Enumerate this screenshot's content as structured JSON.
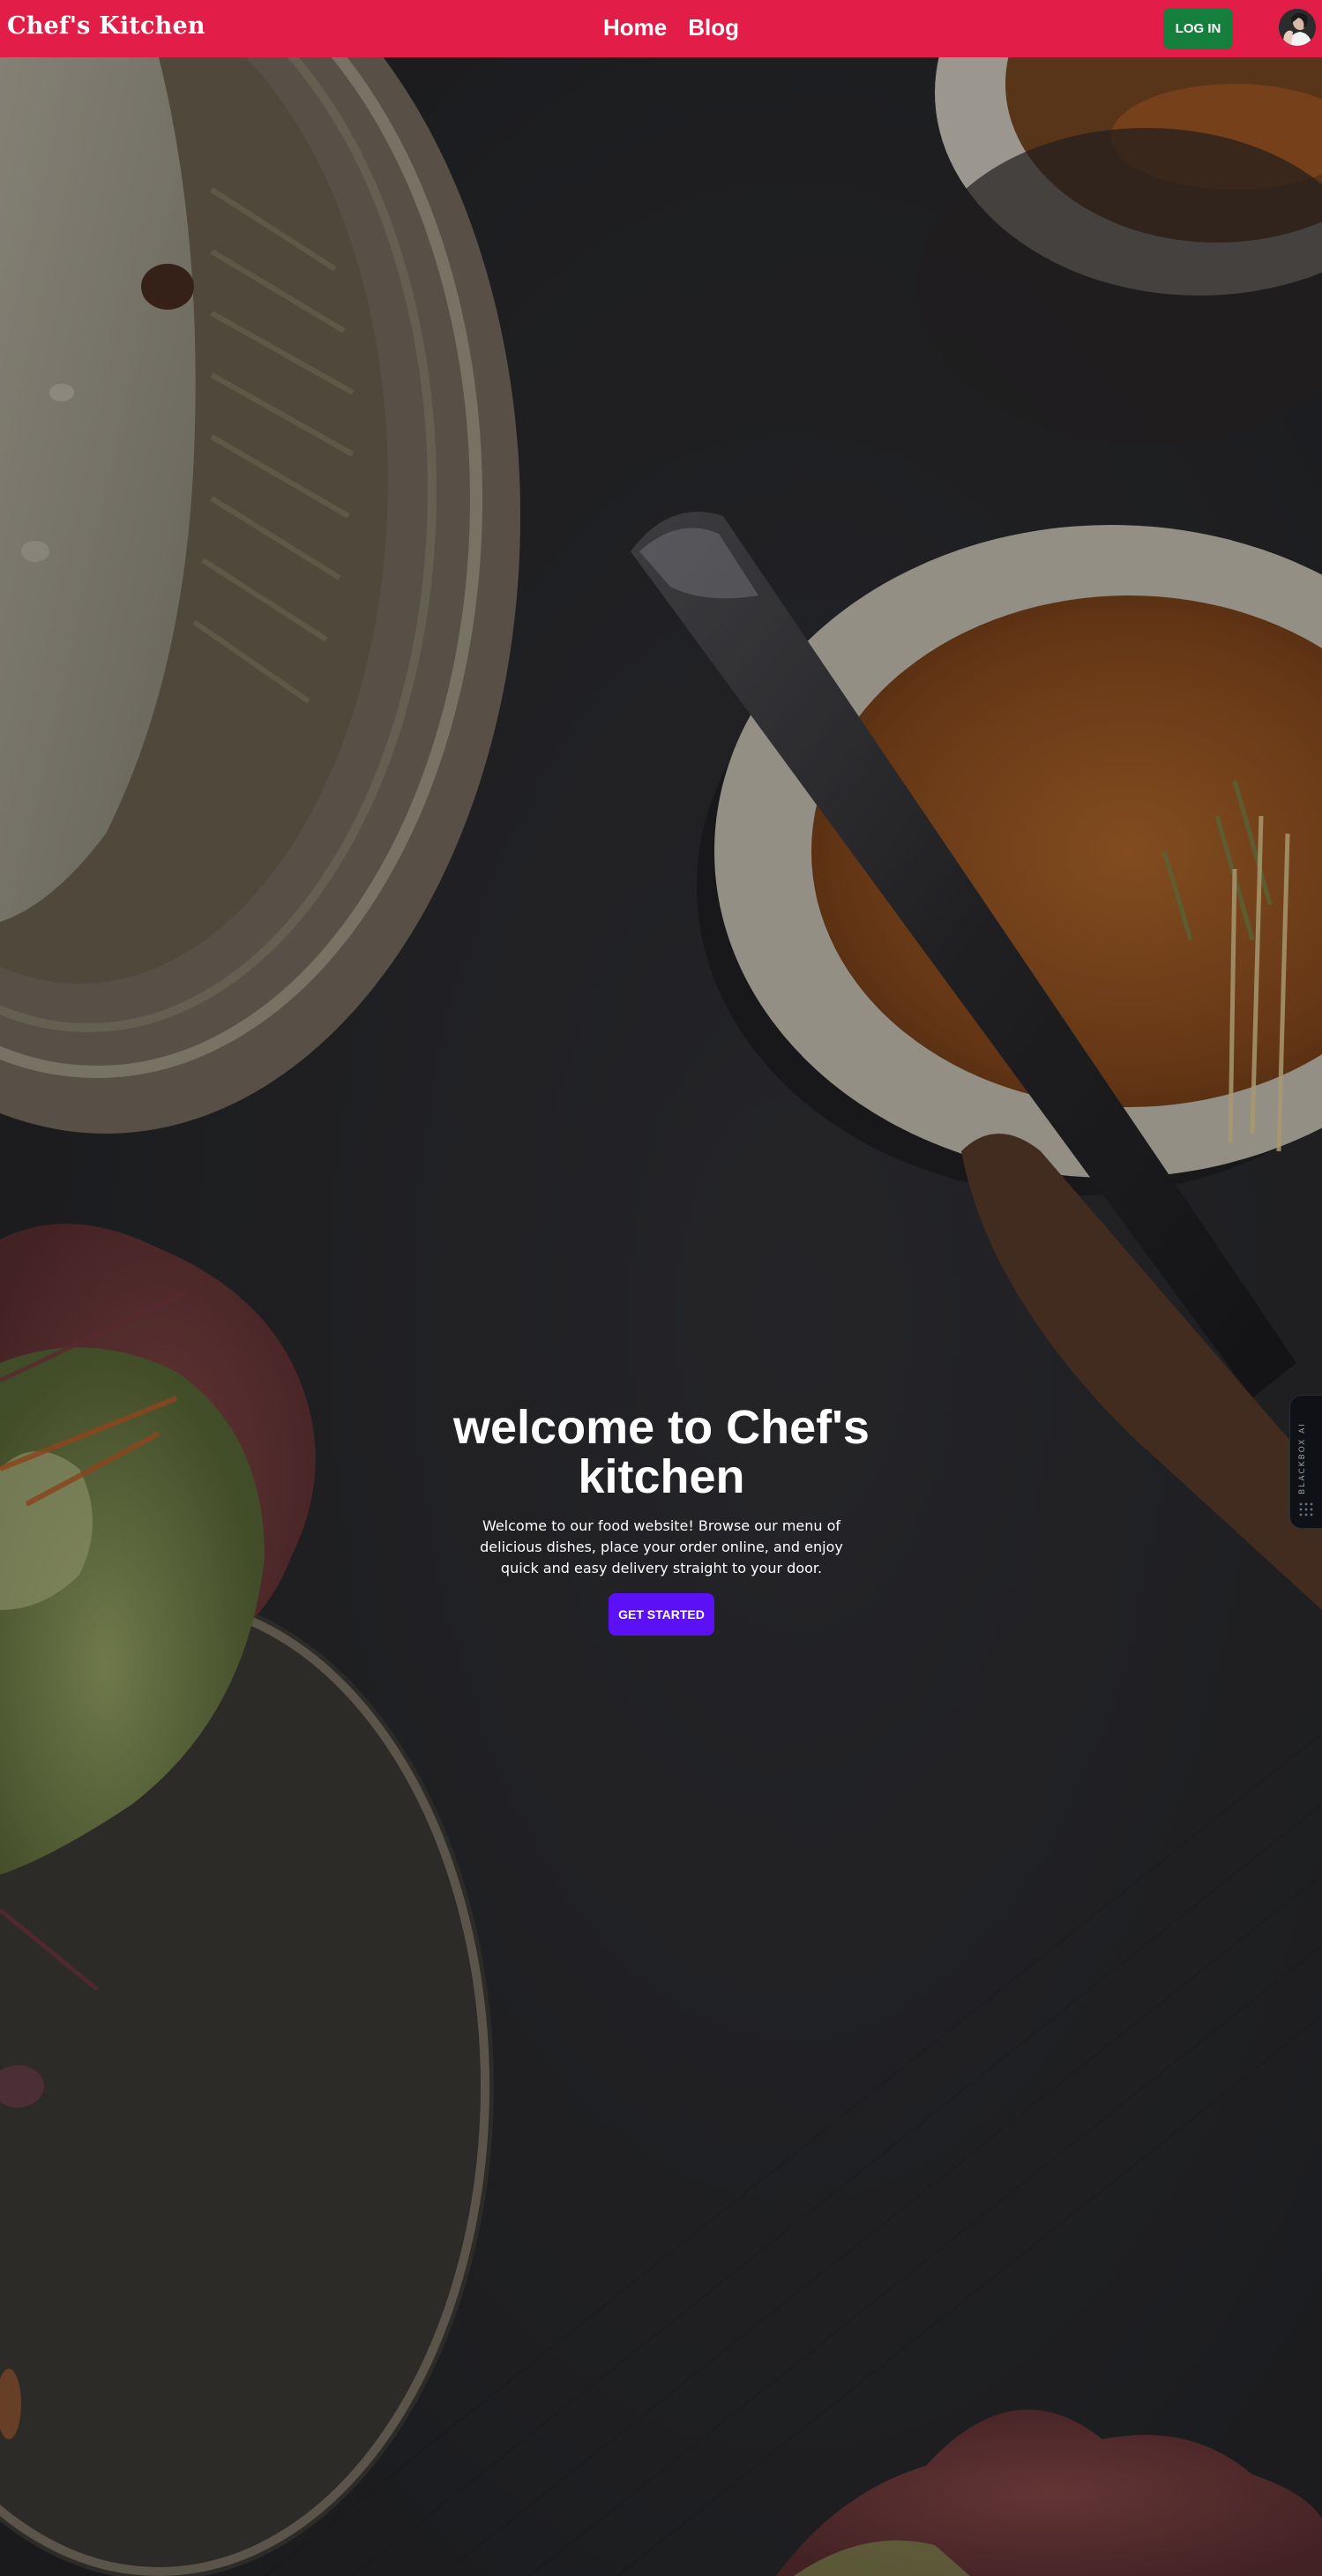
{
  "navbar": {
    "brand": "Chef's Kitchen",
    "links": [
      {
        "label": "Home"
      },
      {
        "label": "Blog"
      }
    ],
    "login_label": "LOG IN",
    "background_color": "#e11d48",
    "login_color": "#15803d"
  },
  "hero": {
    "title": "welcome to Chef's kitchen",
    "description": "Welcome to our food website! Browse our menu of delicious dishes, place your order online, and enjoy quick and easy delivery straight to your door.",
    "cta_label": "GET STARTED",
    "cta_color": "#5b10f5"
  },
  "side_widget": {
    "label": "BLACKBOX AI",
    "icon": "blackbox-dots-icon"
  },
  "background": {
    "icon": "food-photo-background"
  }
}
